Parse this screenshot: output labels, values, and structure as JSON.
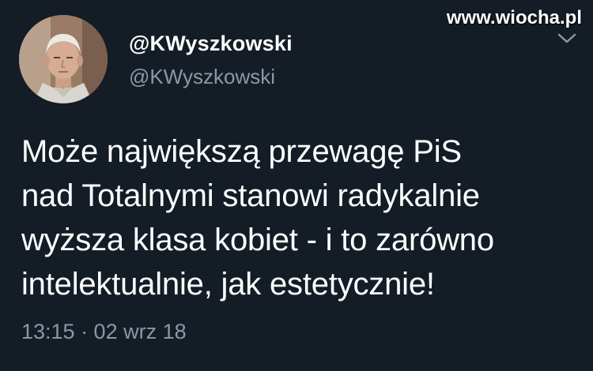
{
  "watermark": "www.wiocha.pl",
  "author": {
    "display_name": "@KWyszkowski",
    "handle": "@KWyszkowski"
  },
  "tweet": {
    "lines": [
      "Może największą przewagę PiS",
      "nad Totalnymi stanowi radykalnie",
      "wyższa klasa kobiet - i to zarówno",
      "intelektualnie, jak estetycznie!"
    ],
    "timestamp": "13:15 · 02 wrz 18"
  },
  "icons": {
    "avatar": "profile-photo",
    "menu": "chevron-down-icon"
  },
  "colors": {
    "background": "#141d26",
    "primary_text": "#ffffff",
    "secondary_text": "#8899a6"
  }
}
